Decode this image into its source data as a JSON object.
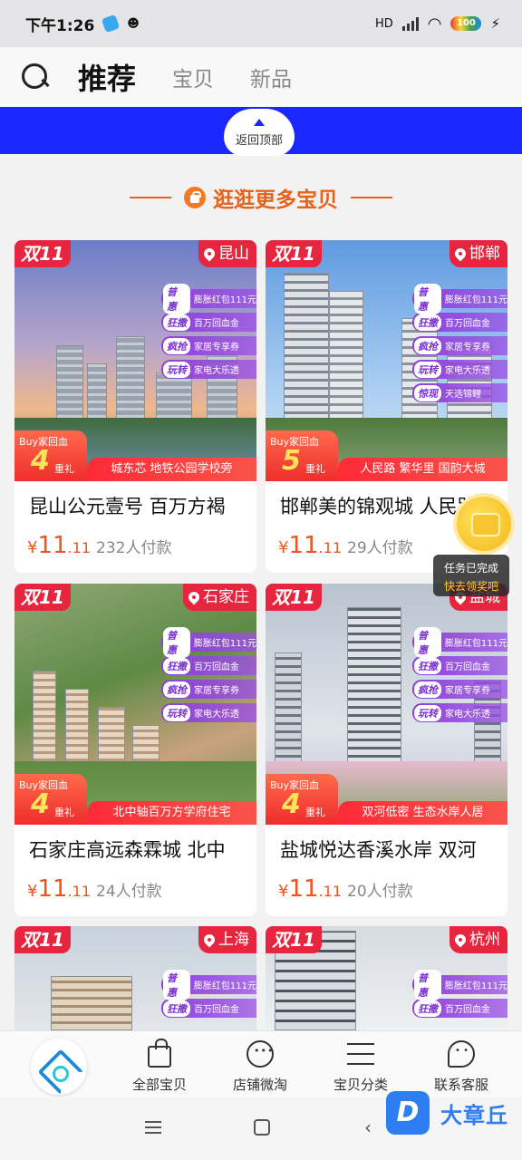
{
  "status_bar": {
    "time": "下午1:26",
    "network": "HD",
    "battery": "100"
  },
  "top_nav": {
    "tabs": [
      "推荐",
      "宝贝",
      "新品"
    ]
  },
  "back_to_top": "返回顶部",
  "section_title": "逛逛更多宝贝",
  "cards": [
    {
      "badge": "双11",
      "city": "昆山",
      "promos": [
        {
          "tag": "普惠",
          "text": "膨胀红包111元"
        },
        {
          "tag": "狂撒",
          "text": "百万回血金"
        },
        {
          "tag": "疯抢",
          "text": "家居专享券"
        },
        {
          "tag": "玩转",
          "text": "家电大乐透"
        }
      ],
      "buy_label": "Buy家回血",
      "buy_num": "4",
      "buy_gift": "重礼",
      "strip": "城东芯 地铁公园学校旁",
      "title": "昆山公元壹号  百万方褐",
      "currency": "¥",
      "price_int": "11",
      "price_dec": ".11",
      "paid": "232人付款"
    },
    {
      "badge": "双11",
      "city": "邯郸",
      "promos": [
        {
          "tag": "普惠",
          "text": "膨胀红包111元"
        },
        {
          "tag": "狂撒",
          "text": "百万回血金"
        },
        {
          "tag": "疯抢",
          "text": "家居专享券"
        },
        {
          "tag": "玩转",
          "text": "家电大乐透"
        },
        {
          "tag": "惊现",
          "text": "天选锦鲤"
        }
      ],
      "buy_label": "Buy家回血",
      "buy_num": "5",
      "buy_gift": "重礼",
      "strip": "人民路 繁华里 国韵大城",
      "title": "邯郸美的锦观城 人民路",
      "currency": "¥",
      "price_int": "11",
      "price_dec": ".11",
      "paid": "29人付款"
    },
    {
      "badge": "双11",
      "city": "石家庄",
      "promos": [
        {
          "tag": "普惠",
          "text": "膨胀红包111元"
        },
        {
          "tag": "狂撒",
          "text": "百万回血金"
        },
        {
          "tag": "疯抢",
          "text": "家居专享券"
        },
        {
          "tag": "玩转",
          "text": "家电大乐透"
        }
      ],
      "buy_label": "Buy家回血",
      "buy_num": "4",
      "buy_gift": "重礼",
      "strip": "北中轴百万方学府住宅",
      "title": "石家庄高远森霖城 北中",
      "currency": "¥",
      "price_int": "11",
      "price_dec": ".11",
      "paid": "24人付款"
    },
    {
      "badge": "双11",
      "city": "盐城",
      "promos": [
        {
          "tag": "普惠",
          "text": "膨胀红包111元"
        },
        {
          "tag": "狂撒",
          "text": "百万回血金"
        },
        {
          "tag": "疯抢",
          "text": "家居专享券"
        },
        {
          "tag": "玩转",
          "text": "家电大乐透"
        }
      ],
      "buy_label": "Buy家回血",
      "buy_num": "4",
      "buy_gift": "重礼",
      "strip": "双河低密 生态水岸人居",
      "title": "盐城悦达香溪水岸 双河",
      "currency": "¥",
      "price_int": "11",
      "price_dec": ".11",
      "paid": "20人付款"
    },
    {
      "badge": "双11",
      "city": "上海",
      "promos": [
        {
          "tag": "普惠",
          "text": "膨胀红包111元"
        },
        {
          "tag": "狂撒",
          "text": "百万回血金"
        }
      ]
    },
    {
      "badge": "双11",
      "city": "杭州",
      "promos": [
        {
          "tag": "普惠",
          "text": "膨胀红包111元"
        },
        {
          "tag": "狂撒",
          "text": "百万回血金"
        }
      ]
    }
  ],
  "reward": {
    "line1": "任务已完成",
    "line2": "快去领奖吧"
  },
  "bottom_nav": {
    "items": [
      "全部宝贝",
      "店铺微淘",
      "宝贝分类",
      "联系客服"
    ]
  },
  "watermark": {
    "logo": "D",
    "text": "大章丘"
  },
  "colors": {
    "accent": "#e8621a",
    "banner": "#1a27ff",
    "badge": "#e8253e",
    "price": "#f0541e",
    "promo": "#8e3fd9"
  }
}
